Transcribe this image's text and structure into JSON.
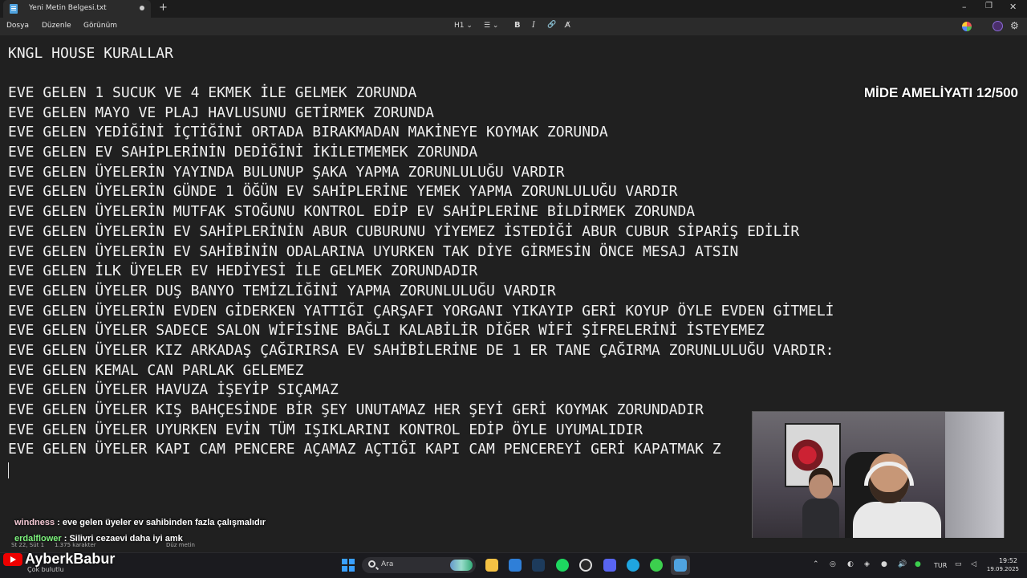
{
  "window": {
    "tab_title": "Yeni Metin Belgesi.txt",
    "new_tab": "+",
    "minimize": "–",
    "maximize": "❐",
    "close": "✕"
  },
  "menu": {
    "file": "Dosya",
    "edit": "Düzenle",
    "view": "Görünüm"
  },
  "toolbar": {
    "heading": "H1 ⌄",
    "list": "☰ ⌄",
    "bold": "B",
    "italic": "I",
    "link": "🔗",
    "clear_format": "A̸",
    "gear": "⚙"
  },
  "document": {
    "title": "KNGL HOUSE KURALLAR",
    "lines": [
      "EVE GELEN 1 SUCUK VE 4 EKMEK İLE GELMEK ZORUNDA",
      "EVE GELEN MAYO VE PLAJ HAVLUSUNU GETİRMEK ZORUNDA",
      "EVE GELEN YEDİĞİNİ İÇTİĞİNİ ORTADA BIRAKMADAN MAKİNEYE KOYMAK ZORUNDA",
      "EVE GELEN EV SAHİPLERİNİN DEDİĞİNİ İKİLETMEMEK ZORUNDA",
      "EVE GELEN ÜYELERİN YAYINDA BULUNUP ŞAKA YAPMA ZORUNLULUĞU VARDIR",
      "EVE GELEN ÜYELERİN GÜNDE 1 ÖĞÜN EV SAHİPLERİNE YEMEK YAPMA ZORUNLULUĞU VARDIR",
      "EVE GELEN ÜYELERİN MUTFAK STOĞUNU KONTROL EDİP EV SAHİPLERİNE BİLDİRMEK ZORUNDA",
      "EVE GELEN ÜYELERİN EV SAHİPLERİNİN ABUR CUBURUNU YİYEMEZ İSTEDİĞİ ABUR CUBUR SİPARİŞ EDİLİR",
      "EVE GELEN ÜYELERİN EV SAHİBİNİN ODALARINA UYURKEN TAK DİYE GİRMESİN ÖNCE MESAJ ATSIN",
      "EVE GELEN İLK ÜYELER EV HEDİYESİ İLE GELMEK ZORUNDADIR",
      "EVE GELEN ÜYELER DUŞ BANYO TEMİZLİĞİNİ YAPMA ZORUNLULUĞU VARDIR",
      "EVE GELEN ÜYELERİN EVDEN GİDERKEN YATTIĞI ÇARŞAFI YORGANI YIKAYIP GERİ KOYUP ÖYLE EVDEN GİTMELİ",
      "EVE GELEN ÜYELER SADECE SALON WİFİSİNE BAĞLI KALABİLİR DİĞER WİFİ ŞİFRELERİNİ İSTEYEMEZ",
      "EVE GELEN ÜYELER KIZ ARKADAŞ ÇAĞIRIRSA EV SAHİBİLERİNE DE 1 ER TANE ÇAĞIRMA ZORUNLULUĞU VARDIR:",
      "EVE GELEN KEMAL CAN PARLAK GELEMEZ",
      "EVE GELEN ÜYELER HAVUZA İŞEYİP SIÇAMAZ",
      "EVE GELEN ÜYELER KIŞ BAHÇESİNDE BİR ŞEY UNUTAMAZ HER ŞEYİ GERİ KOYMAK ZORUNDADIR",
      "EVE GELEN ÜYELER UYURKEN EVİN TÜM IŞIKLARINI KONTROL EDİP ÖYLE UYUMALIDIR",
      "EVE GELEN ÜYELER KAPI CAM PENCERE AÇAMAZ AÇTIĞI KAPI CAM PENCEREYİ GERİ KAPATMAK Z"
    ]
  },
  "overlay": {
    "counter": "MİDE AMELİYATI 12/500"
  },
  "status": {
    "position": "St 22, Süt 1",
    "chars": "1.375 karakter",
    "format": "Düz metin"
  },
  "chat": [
    {
      "user": "windness",
      "message": " : eve gelen üyeler ev sahibinden fazla çalışmalıdır"
    },
    {
      "user": "erdalflower",
      "message": " : Silivri cezaevi daha iyi amk"
    }
  ],
  "channel": {
    "name": "AyberkBabur",
    "taskbar_sub": "Çok bulutlu"
  },
  "taskbar": {
    "search_placeholder": "Ara",
    "language": "TUR",
    "time": "19:52",
    "date": "19.09.2025"
  },
  "colors": {
    "editor_bg": "#202020",
    "text": "#f0f0f0",
    "chat_user1": "#f2c7d3",
    "chat_user2": "#7cf27c",
    "youtube_red": "#ee0000",
    "windows_blue": "#3aa0ff"
  }
}
